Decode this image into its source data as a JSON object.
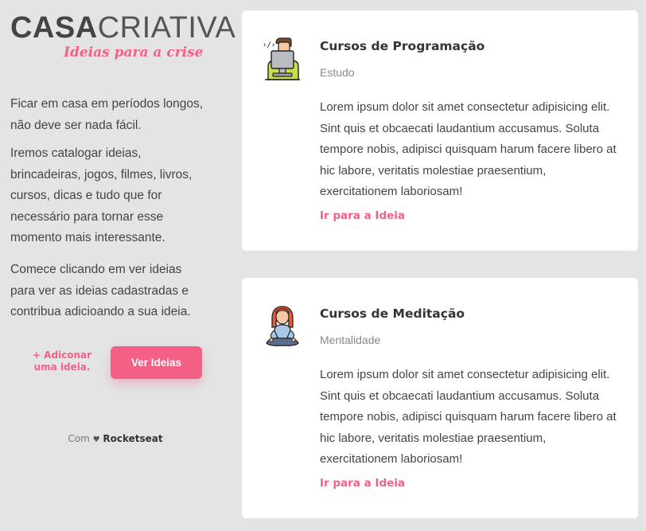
{
  "brand": {
    "title_bold": "CASA",
    "title_light": "CRIATIVA",
    "subtitle": "Ideias para a crise"
  },
  "intro": {
    "p1": "Ficar em casa em períodos longos, não deve ser nada fácil.",
    "p2": "Iremos catalogar ideias, brincadeiras, jogos, filmes, livros, cursos, dicas e tudo que for necessário para tornar esse momento mais interessante.",
    "p3": "Comece clicando em ver ideias para ver as ideias cadastradas e contribua adicioando a sua ideia."
  },
  "actions": {
    "add_label": "+ Adiconar uma ideia.",
    "view_label": "Ver Ideias"
  },
  "footer": {
    "prefix": "Com",
    "heart": "♥",
    "brand": "Rocketseat"
  },
  "ideas": [
    {
      "title": "Cursos de Programação",
      "category": "Estudo",
      "description": "Lorem ipsum dolor sit amet consectetur adipisicing elit. Sint quis et obcaecati laudantium accusamus. Soluta tempore nobis, adipisci quisquam harum facere libero at hic labore, veritatis molestiae praesentium, exercitationem laboriosam!",
      "link": "Ir para a Ideia",
      "icon": "programmer-icon"
    },
    {
      "title": "Cursos de Meditação",
      "category": "Mentalidade",
      "description": "Lorem ipsum dolor sit amet consectetur adipisicing elit. Sint quis et obcaecati laudantium accusamus. Soluta tempore nobis, adipisci quisquam harum facere libero at hic labore, veritatis molestiae praesentium, exercitationem laboriosam!",
      "link": "Ir para a Ideia",
      "icon": "meditation-icon"
    }
  ],
  "colors": {
    "accent": "#f45f86",
    "background": "#e4e4e4",
    "card": "#ffffff"
  }
}
